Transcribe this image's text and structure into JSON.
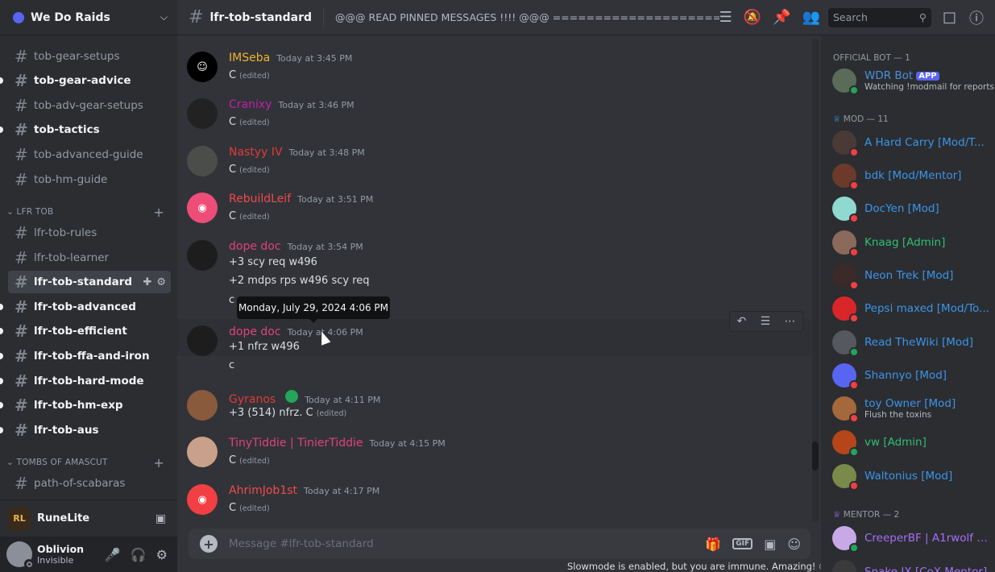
{
  "server": {
    "name": "We Do Raids"
  },
  "channels": [
    {
      "name": "tob-gear-setups",
      "unread": false
    },
    {
      "name": "tob-gear-advice",
      "unread": true
    },
    {
      "name": "tob-adv-gear-setups",
      "unread": false
    },
    {
      "name": "tob-tactics",
      "unread": true
    },
    {
      "name": "tob-advanced-guide",
      "unread": false
    },
    {
      "name": "tob-hm-guide",
      "unread": false
    }
  ],
  "categories": {
    "lfr": "LFR TOB",
    "toa": "TOMBS OF AMASCUT"
  },
  "lfr_channels": [
    {
      "name": "lfr-tob-rules",
      "unread": false
    },
    {
      "name": "lfr-tob-learner",
      "unread": false
    },
    {
      "name": "lfr-tob-standard",
      "unread": false
    },
    {
      "name": "lfr-tob-advanced",
      "unread": true
    },
    {
      "name": "lfr-tob-efficient",
      "unread": true
    },
    {
      "name": "lfr-tob-ffa-and-iron",
      "unread": true
    },
    {
      "name": "lfr-tob-hard-mode",
      "unread": true
    },
    {
      "name": "lfr-tob-hm-exp",
      "unread": true
    },
    {
      "name": "lfr-tob-aus",
      "unread": true
    }
  ],
  "toa_channels": [
    {
      "name": "path-of-scabaras"
    }
  ],
  "activity": {
    "name": "RuneLite",
    "logo": "RL"
  },
  "user": {
    "name": "Oblivion",
    "status": "Invisible"
  },
  "topbar": {
    "channel": "lfr-tob-standard",
    "topic": "@@@ READ PINNED MESSAGES !!!! @@@ ====================>",
    "search_placeholder": "Search"
  },
  "messages": [
    {
      "author": "IMSeba",
      "color": "#f0b232",
      "time": "Today at 3:45 PM",
      "lines": [
        "C"
      ],
      "edited": true
    },
    {
      "author": "Cranixy",
      "color": "#c21fae",
      "time": "Today at 3:46 PM",
      "lines": [
        "C"
      ],
      "edited": true
    },
    {
      "author": "Nastyy IV",
      "color": "#e03a3a",
      "time": "Today at 3:48 PM",
      "lines": [
        "C"
      ],
      "edited": true
    },
    {
      "author": "RebuildLeif",
      "color": "#f04a4a",
      "time": "Today at 3:51 PM",
      "lines": [
        "C"
      ],
      "edited": true
    },
    {
      "author": "dope doc",
      "color": "#e0427a",
      "time": "Today at 3:54 PM",
      "lines": [
        "+3 scy req w496",
        "+2 mdps rps w496 scy req",
        "c"
      ]
    },
    {
      "author": "dope doc",
      "color": "#e0427a",
      "time": "Today at 4:06 PM",
      "lines": [
        "+1 nfrz w496",
        "c"
      ]
    },
    {
      "author": "Gyranos",
      "color": "#e03a3a",
      "time": "Today at 4:11 PM",
      "lines": [
        "+3 (514) nfrz. C"
      ],
      "edited": true
    },
    {
      "author": "TinyTiddie | TinierTiddie",
      "color": "#e0427a",
      "time": "Today at 4:15 PM",
      "lines": [
        "C"
      ],
      "edited": true
    },
    {
      "author": "AhrimJob1st",
      "color": "#f04a4a",
      "time": "Today at 4:17 PM",
      "lines": [
        "C"
      ],
      "edited": true
    }
  ],
  "edited_label": "(edited)",
  "tooltip": "Monday, July 29, 2024 4:06 PM",
  "composer": {
    "placeholder": "Message #lfr-tob-standard",
    "gif": "GIF"
  },
  "slowmode": "Slowmode is enabled, but you are immune. Amazing!",
  "member_list": {
    "roles": {
      "bot": "OFFICIAL BOT — 1",
      "mod": "MOD — 11",
      "mentor": "MENTOR — 2"
    },
    "bot": {
      "name": "WDR Bot",
      "tag": "APP",
      "sub": "Watching !modmail for reports",
      "color": "#4a90d9"
    },
    "mods": [
      {
        "name": "A Hard Carry [Mod/T...",
        "color": "#3b95e8",
        "status": "dnd"
      },
      {
        "name": "bdk [Mod/Mentor]",
        "color": "#3b95e8",
        "status": "dnd"
      },
      {
        "name": "DocYen [Mod]",
        "color": "#3b95e8",
        "status": "dnd"
      },
      {
        "name": "Knaag [Admin]",
        "color": "#2fbf71",
        "status": "dnd"
      },
      {
        "name": "Neon Trek [Mod]",
        "color": "#3b95e8",
        "status": "dnd"
      },
      {
        "name": "Pepsi maxed [Mod/To...",
        "color": "#3b95e8",
        "status": "dnd"
      },
      {
        "name": "Read TheWiki [Mod]",
        "color": "#3b95e8",
        "status": "online"
      },
      {
        "name": "Shannyo [Mod]",
        "color": "#3b95e8",
        "status": "dnd"
      },
      {
        "name": "toy Owner [Mod]",
        "color": "#3b95e8",
        "status": "dnd",
        "sub": "Flush the toxins"
      },
      {
        "name": "vw [Admin]",
        "color": "#2fbf71",
        "status": "online"
      },
      {
        "name": "Waltonius [Mod]",
        "color": "#3b95e8",
        "status": "dnd"
      }
    ],
    "mentors": [
      {
        "name": "CreeperBF | A1rwolf [...",
        "color": "#a66ef5",
        "status": "online"
      },
      {
        "name": "Snake IX [CoX Mentor]",
        "color": "#a66ef5",
        "status": "online"
      }
    ]
  }
}
